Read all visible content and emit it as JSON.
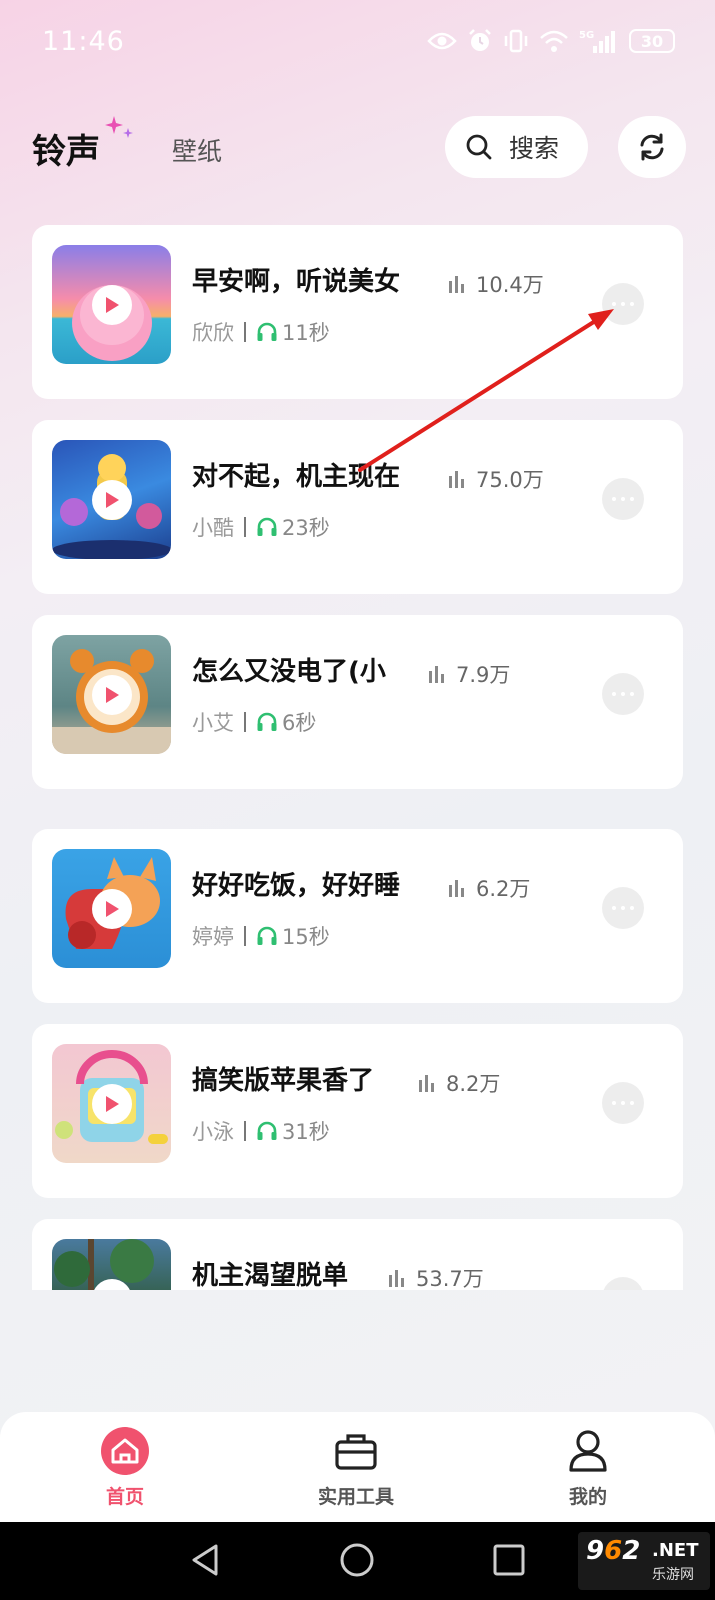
{
  "status_bar": {
    "time": "11:46",
    "network": "5G",
    "battery": "30"
  },
  "header": {
    "tab_ringtone": "铃声",
    "tab_wallpaper": "壁纸",
    "search_label": "搜索"
  },
  "ringtones": [
    {
      "title": "早安啊，听说美女",
      "plays": "10.4万",
      "author": "欣欣",
      "duration": "11秒"
    },
    {
      "title": "对不起，机主现在",
      "plays": "75.0万",
      "author": "小酷",
      "duration": "23秒"
    },
    {
      "title": "怎么又没电了(小",
      "plays": "7.9万",
      "author": "小艾",
      "duration": "6秒"
    },
    {
      "title": "好好吃饭，好好睡",
      "plays": "6.2万",
      "author": "婷婷",
      "duration": "15秒"
    },
    {
      "title": "搞笑版苹果香了",
      "plays": "8.2万",
      "author": "小泳",
      "duration": "31秒"
    },
    {
      "title": "机主渴望脱单",
      "plays": "53.7万",
      "author": "",
      "duration": ""
    }
  ],
  "bottom_nav": {
    "home": "首页",
    "tools": "实用工具",
    "mine": "我的"
  },
  "watermark": {
    "num_a": "9",
    "num_b": "6",
    "num_c": "2",
    "net": ".NET",
    "sub": "乐游网"
  },
  "colors": {
    "accent": "#f0526e",
    "icon_green": "#2fbf71",
    "annotation_arrow": "#e0201c"
  }
}
